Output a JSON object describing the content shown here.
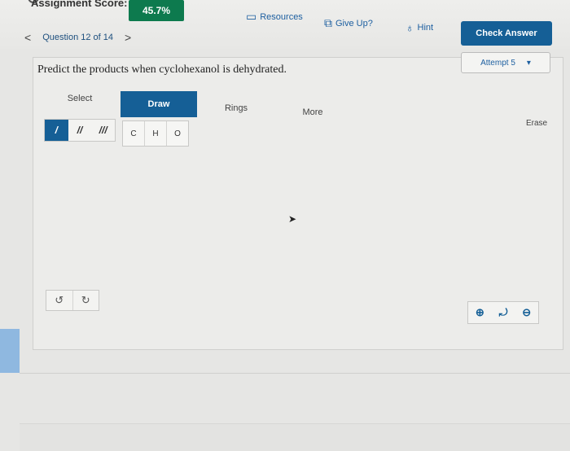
{
  "header": {
    "score_label": "Assignment Score:",
    "score_value": "45.7%",
    "resources": "Resources",
    "give_up": "Give Up?",
    "hint": "Hint",
    "check_answer": "Check Answer"
  },
  "question_nav": {
    "prev": "<",
    "label": "Question 12 of 14",
    "next": ">"
  },
  "attempt": {
    "label": "Attempt 5",
    "caret": "▾"
  },
  "prompt": "Predict the products when cyclohexanol is dehydrated.",
  "tabs": [
    {
      "label": "Select"
    },
    {
      "label": "Draw"
    },
    {
      "label": "Rings"
    },
    {
      "label": "More"
    }
  ],
  "bonds": [
    "/",
    "//",
    "///"
  ],
  "atoms": [
    "C",
    "H",
    "O"
  ],
  "erase": "Erase",
  "undo_icons": [
    "undo-icon",
    "redo-icon"
  ],
  "zoom_icons": [
    "zoom-in-icon",
    "reset-icon",
    "zoom-out-icon"
  ],
  "colors": {
    "accent": "#155f96",
    "score": "#0d7a4e"
  }
}
